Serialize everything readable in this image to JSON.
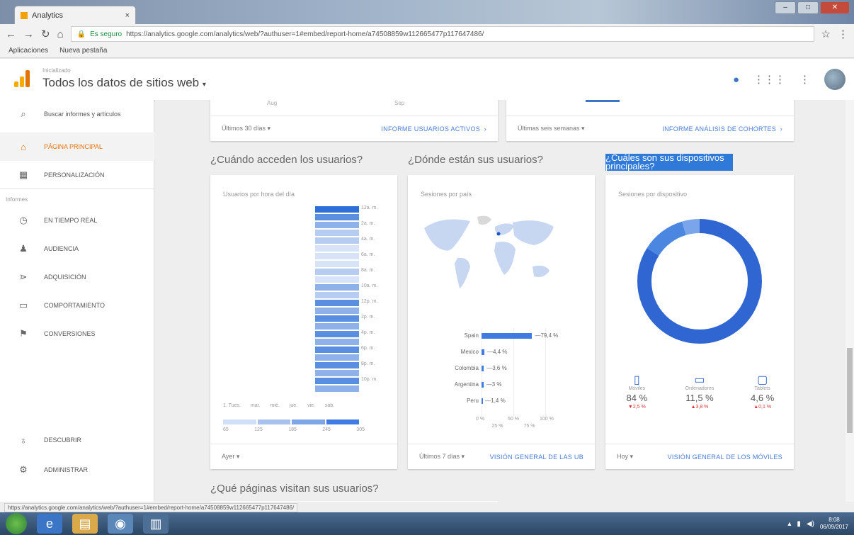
{
  "browser": {
    "tab_title": "Analytics",
    "tab_close": "×",
    "url_secure": "Es seguro",
    "url": "https://analytics.google.com/analytics/web/?authuser=1#embed/report-home/a74508859w112665477p117647486/",
    "bookmarks": [
      "Aplicaciones",
      "Nueva pestaña"
    ]
  },
  "header": {
    "subtitle": "Inicializado",
    "title": "Todos los datos de sitios web"
  },
  "sidebar": {
    "search": "Buscar informes y artículos",
    "section_label": "Informes",
    "items": [
      {
        "label": "PÁGINA PRINCIPAL",
        "icon": "home-icon"
      },
      {
        "label": "PERSONALIZACIÓN",
        "icon": "grid-icon"
      },
      {
        "label": "EN TIEMPO REAL",
        "icon": "clock-icon"
      },
      {
        "label": "AUDIENCIA",
        "icon": "person-icon"
      },
      {
        "label": "ADQUISICIÓN",
        "icon": "acquisition-icon"
      },
      {
        "label": "COMPORTAMIENTO",
        "icon": "behavior-icon"
      },
      {
        "label": "CONVERSIONES",
        "icon": "flag-icon"
      },
      {
        "label": "DESCUBRIR",
        "icon": "bulb-icon"
      },
      {
        "label": "ADMINISTRAR",
        "icon": "gear-icon"
      }
    ]
  },
  "top_cards": {
    "left_tick_a": "Aug",
    "left_tick_b": "Sep",
    "left_range": "Últimos 30 días",
    "left_link": "INFORME USUARIOS ACTIVOS",
    "right_range": "Últimas seis semanas",
    "right_link": "INFORME ANÁLISIS DE COHORTES"
  },
  "sections": {
    "when": "¿Cuándo acceden los usuarios?",
    "where": "¿Dónde están sus usuarios?",
    "devices": "¿Cuáles son sus dispositivos principales?",
    "pages": "¿Qué páginas visitan sus usuarios?"
  },
  "hour_card": {
    "title": "Usuarios por hora del día",
    "hour_labels": [
      "12a. m.",
      "2a. m.",
      "4a. m.",
      "6a. m.",
      "8a. m.",
      "10a. m.",
      "12p. m.",
      "2p. m.",
      "4p. m.",
      "6p. m.",
      "8p. m.",
      "10p. m."
    ],
    "day_labels": [
      "1. Tues.",
      "mar.",
      "mié.",
      "jue.",
      "vie.",
      "sáb."
    ],
    "scale_labels": [
      "65",
      "125",
      "185",
      "245",
      "305"
    ],
    "range": "Ayer"
  },
  "country_card": {
    "title": "Sesiones por país",
    "range": "Últimos 7 días",
    "link": "VISIÓN GENERAL DE LAS UB",
    "axis_top": [
      "0 %",
      "50 %",
      "100 %"
    ],
    "axis_bottom": [
      "25 %",
      "75 %"
    ]
  },
  "device_card": {
    "title": "Sesiones por dispositivo",
    "range": "Hoy",
    "link": "VISIÓN GENERAL DE LOS MÓVILES",
    "devices": [
      {
        "name": "Móviles",
        "value": "84 %",
        "change": "▼2,5 %",
        "icon": "phone-icon"
      },
      {
        "name": "Ordenadores",
        "value": "11,5 %",
        "change": "▲3,8 %",
        "icon": "desktop-icon"
      },
      {
        "name": "Tablets",
        "value": "4,6 %",
        "change": "▲0,1 %",
        "icon": "tablet-icon"
      }
    ]
  },
  "chart_data": [
    {
      "type": "bar",
      "title": "Sesiones por país",
      "categories": [
        "Spain",
        "Mexico",
        "Colombia",
        "Argentina",
        "Peru"
      ],
      "values": [
        79.4,
        4.4,
        3.6,
        3.0,
        1.4
      ],
      "labels": [
        "79,4 %",
        "4,4 %",
        "3,6 %",
        "3 %",
        "1,4 %"
      ],
      "xlim": [
        0,
        100
      ]
    },
    {
      "type": "pie",
      "title": "Sesiones por dispositivo",
      "categories": [
        "Móviles",
        "Ordenadores",
        "Tablets"
      ],
      "values": [
        84,
        11.5,
        4.6
      ]
    },
    {
      "type": "heatmap",
      "title": "Usuarios por hora del día",
      "categories": [
        "12a. m.",
        "2a. m.",
        "4a. m.",
        "6a. m.",
        "8a. m.",
        "10a. m.",
        "12p. m.",
        "2p. m.",
        "4p. m.",
        "6p. m.",
        "8p. m.",
        "10p. m."
      ],
      "values": [
        305,
        185,
        125,
        65,
        125,
        185,
        245,
        245,
        245,
        245,
        245,
        245
      ]
    }
  ],
  "taskbar": {
    "clock_time": "8:08",
    "clock_date": "06/09/2017"
  },
  "status_url": "https://analytics.google.com/analytics/web/?authuser=1#embed/report-home/a74508859w112665477p117647486/"
}
